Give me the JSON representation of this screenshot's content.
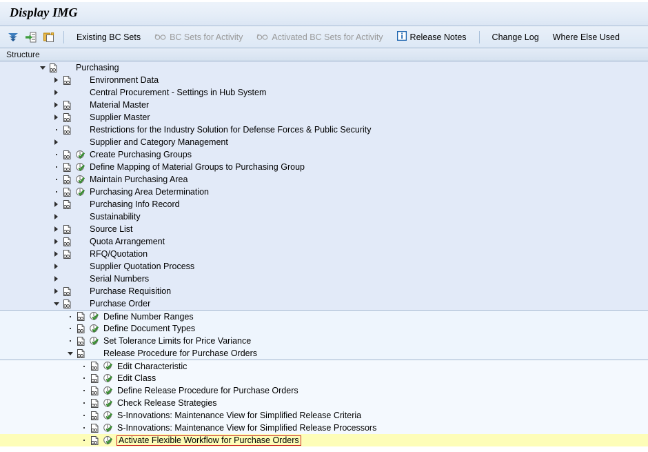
{
  "window": {
    "title": "Display IMG"
  },
  "toolbar": {
    "icons": [
      {
        "name": "filter-icon",
        "label": "Filter"
      },
      {
        "name": "expand-node-icon",
        "label": "Expand Node"
      },
      {
        "name": "clipboard-icon",
        "label": "Clipboard"
      }
    ],
    "buttons": [
      {
        "name": "existing-bc-sets",
        "label": "Existing BC Sets",
        "icon": "",
        "disabled": false
      },
      {
        "name": "bc-sets-for-activity",
        "label": "BC Sets for Activity",
        "icon": "glasses-icon",
        "disabled": true
      },
      {
        "name": "activated-bc-sets-for-activity",
        "label": "Activated BC Sets for Activity",
        "icon": "glasses-icon",
        "disabled": true
      },
      {
        "name": "release-notes",
        "label": "Release Notes",
        "icon": "info-icon",
        "disabled": false
      },
      {
        "name": "change-log",
        "label": "Change Log",
        "icon": "",
        "disabled": false
      },
      {
        "name": "where-else-used",
        "label": "Where Else Used",
        "icon": "",
        "disabled": false
      }
    ]
  },
  "column_header": {
    "structure": "Structure"
  },
  "colors": {
    "band1": "#e2eaf8",
    "band2": "#eaf1fd",
    "band3": "#eef5fd",
    "band4": "#f4f9fe",
    "selected": "#fdfdb8",
    "selection_border": "#cc2222"
  },
  "tree": {
    "rows": [
      {
        "label": "Purchasing",
        "depth": 0,
        "twisty": "open",
        "doc": true,
        "activity": false,
        "band": 1,
        "group_top": false,
        "selected": false
      },
      {
        "label": "Environment Data",
        "depth": 1,
        "twisty": "closed",
        "doc": true,
        "activity": false,
        "band": 1,
        "group_top": false,
        "selected": false
      },
      {
        "label": "Central Procurement - Settings in Hub System",
        "depth": 1,
        "twisty": "closed",
        "doc": false,
        "activity": false,
        "band": 1,
        "group_top": false,
        "selected": false
      },
      {
        "label": "Material Master",
        "depth": 1,
        "twisty": "closed",
        "doc": true,
        "activity": false,
        "band": 1,
        "group_top": false,
        "selected": false
      },
      {
        "label": "Supplier Master",
        "depth": 1,
        "twisty": "closed",
        "doc": true,
        "activity": false,
        "band": 1,
        "group_top": false,
        "selected": false
      },
      {
        "label": "Restrictions for the Industry Solution for Defense Forces & Public Security",
        "depth": 1,
        "twisty": "dot",
        "doc": true,
        "activity": false,
        "band": 1,
        "group_top": false,
        "selected": false
      },
      {
        "label": "Supplier and Category Management",
        "depth": 1,
        "twisty": "closed",
        "doc": false,
        "activity": false,
        "band": 1,
        "group_top": false,
        "selected": false
      },
      {
        "label": "Create Purchasing Groups",
        "depth": 1,
        "twisty": "dot",
        "doc": true,
        "activity": true,
        "band": 1,
        "group_top": false,
        "selected": false
      },
      {
        "label": "Define Mapping of Material Groups to Purchasing Group",
        "depth": 1,
        "twisty": "dot",
        "doc": true,
        "activity": true,
        "band": 1,
        "group_top": false,
        "selected": false
      },
      {
        "label": "Maintain Purchasing Area",
        "depth": 1,
        "twisty": "dot",
        "doc": true,
        "activity": true,
        "band": 1,
        "group_top": false,
        "selected": false
      },
      {
        "label": "Purchasing Area Determination",
        "depth": 1,
        "twisty": "dot",
        "doc": true,
        "activity": true,
        "band": 1,
        "group_top": false,
        "selected": false
      },
      {
        "label": "Purchasing Info Record",
        "depth": 1,
        "twisty": "closed",
        "doc": true,
        "activity": false,
        "band": 1,
        "group_top": false,
        "selected": false
      },
      {
        "label": "Sustainability",
        "depth": 1,
        "twisty": "closed",
        "doc": false,
        "activity": false,
        "band": 1,
        "group_top": false,
        "selected": false
      },
      {
        "label": "Source List",
        "depth": 1,
        "twisty": "closed",
        "doc": true,
        "activity": false,
        "band": 1,
        "group_top": false,
        "selected": false
      },
      {
        "label": "Quota Arrangement",
        "depth": 1,
        "twisty": "closed",
        "doc": true,
        "activity": false,
        "band": 1,
        "group_top": false,
        "selected": false
      },
      {
        "label": "RFQ/Quotation",
        "depth": 1,
        "twisty": "closed",
        "doc": true,
        "activity": false,
        "band": 1,
        "group_top": false,
        "selected": false
      },
      {
        "label": "Supplier Quotation Process",
        "depth": 1,
        "twisty": "closed",
        "doc": false,
        "activity": false,
        "band": 1,
        "group_top": false,
        "selected": false
      },
      {
        "label": "Serial Numbers",
        "depth": 1,
        "twisty": "closed",
        "doc": false,
        "activity": false,
        "band": 1,
        "group_top": false,
        "selected": false
      },
      {
        "label": "Purchase Requisition",
        "depth": 1,
        "twisty": "closed",
        "doc": true,
        "activity": false,
        "band": 1,
        "group_top": false,
        "selected": false
      },
      {
        "label": "Purchase Order",
        "depth": 1,
        "twisty": "open",
        "doc": true,
        "activity": false,
        "band": 1,
        "group_top": false,
        "selected": false
      },
      {
        "label": "Define Number Ranges",
        "depth": 2,
        "twisty": "dot",
        "doc": true,
        "activity": true,
        "band": 3,
        "group_top": true,
        "selected": false
      },
      {
        "label": "Define Document Types",
        "depth": 2,
        "twisty": "dot",
        "doc": true,
        "activity": true,
        "band": 3,
        "group_top": false,
        "selected": false
      },
      {
        "label": "Set Tolerance Limits for Price Variance",
        "depth": 2,
        "twisty": "dot",
        "doc": true,
        "activity": true,
        "band": 3,
        "group_top": false,
        "selected": false
      },
      {
        "label": "Release Procedure for Purchase Orders",
        "depth": 2,
        "twisty": "open",
        "doc": true,
        "activity": false,
        "band": 3,
        "group_top": false,
        "selected": false
      },
      {
        "label": "Edit Characteristic",
        "depth": 3,
        "twisty": "dot",
        "doc": true,
        "activity": true,
        "band": 4,
        "group_top": true,
        "selected": false
      },
      {
        "label": "Edit Class",
        "depth": 3,
        "twisty": "dot",
        "doc": true,
        "activity": true,
        "band": 4,
        "group_top": false,
        "selected": false
      },
      {
        "label": "Define Release Procedure for Purchase Orders",
        "depth": 3,
        "twisty": "dot",
        "doc": true,
        "activity": true,
        "band": 4,
        "group_top": false,
        "selected": false
      },
      {
        "label": "Check Release Strategies",
        "depth": 3,
        "twisty": "dot",
        "doc": true,
        "activity": true,
        "band": 4,
        "group_top": false,
        "selected": false
      },
      {
        "label": "S-Innovations: Maintenance View for Simplified Release Criteria",
        "depth": 3,
        "twisty": "dot",
        "doc": true,
        "activity": true,
        "band": 4,
        "group_top": false,
        "selected": false
      },
      {
        "label": "S-Innovations: Maintenance View for Simplified Release Processors",
        "depth": 3,
        "twisty": "dot",
        "doc": true,
        "activity": true,
        "band": 4,
        "group_top": false,
        "selected": false
      },
      {
        "label": "Activate Flexible Workflow for Purchase Orders",
        "depth": 3,
        "twisty": "dot",
        "doc": true,
        "activity": true,
        "band": 4,
        "group_top": false,
        "selected": true
      }
    ]
  }
}
